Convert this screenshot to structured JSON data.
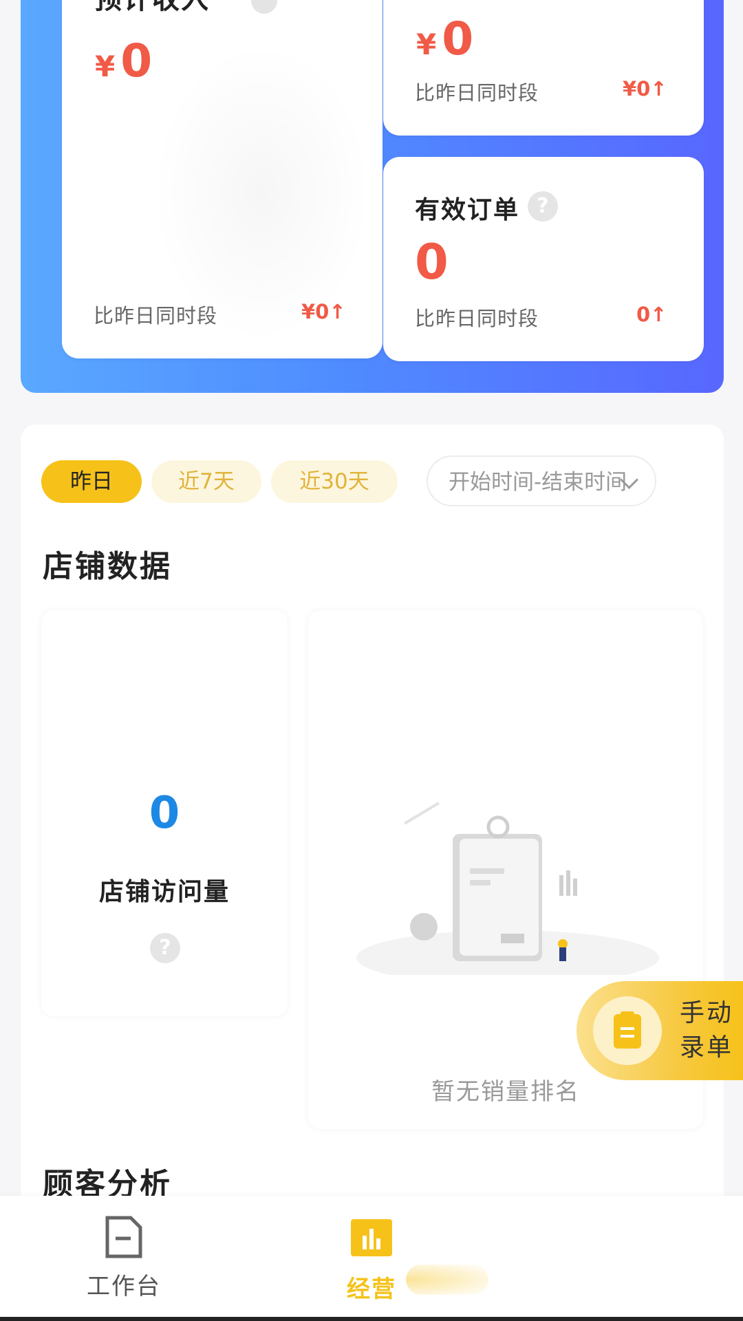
{
  "revenue_card": {
    "title": "预计收入",
    "yen": "¥",
    "value": "0",
    "compare_label": "比昨日同时段",
    "compare_value": "¥0↑"
  },
  "top_right_card": {
    "yen": "¥",
    "value": "0",
    "compare_label": "比昨日同时段",
    "compare_value": "¥0↑"
  },
  "orders_card": {
    "title": "有效订单",
    "value": "0",
    "compare_label": "比昨日同时段",
    "compare_value": "0↑"
  },
  "filters": {
    "chips": [
      "昨日",
      "近7天",
      "近30天"
    ],
    "active_chip": "昨日",
    "date_range_placeholder": "开始时间-结束时间"
  },
  "store_data": {
    "title": "店铺数据",
    "visits_value": "0",
    "visits_label": "店铺访问量",
    "empty_ranking_text": "暂无销量排名"
  },
  "customer_analysis": {
    "title": "顾客分析"
  },
  "fab": {
    "line1": "手动",
    "line2": "录单"
  },
  "tabbar": {
    "items": [
      {
        "label": "工作台",
        "icon": "document-icon"
      },
      {
        "label": "经营",
        "icon": "bar-chart-icon"
      }
    ],
    "active": "经营"
  },
  "colors": {
    "accent": "#f6c21a",
    "money": "#f05a46",
    "visits": "#1e88e5",
    "banner_start": "#5aa8ff",
    "banner_end": "#5867ff"
  }
}
